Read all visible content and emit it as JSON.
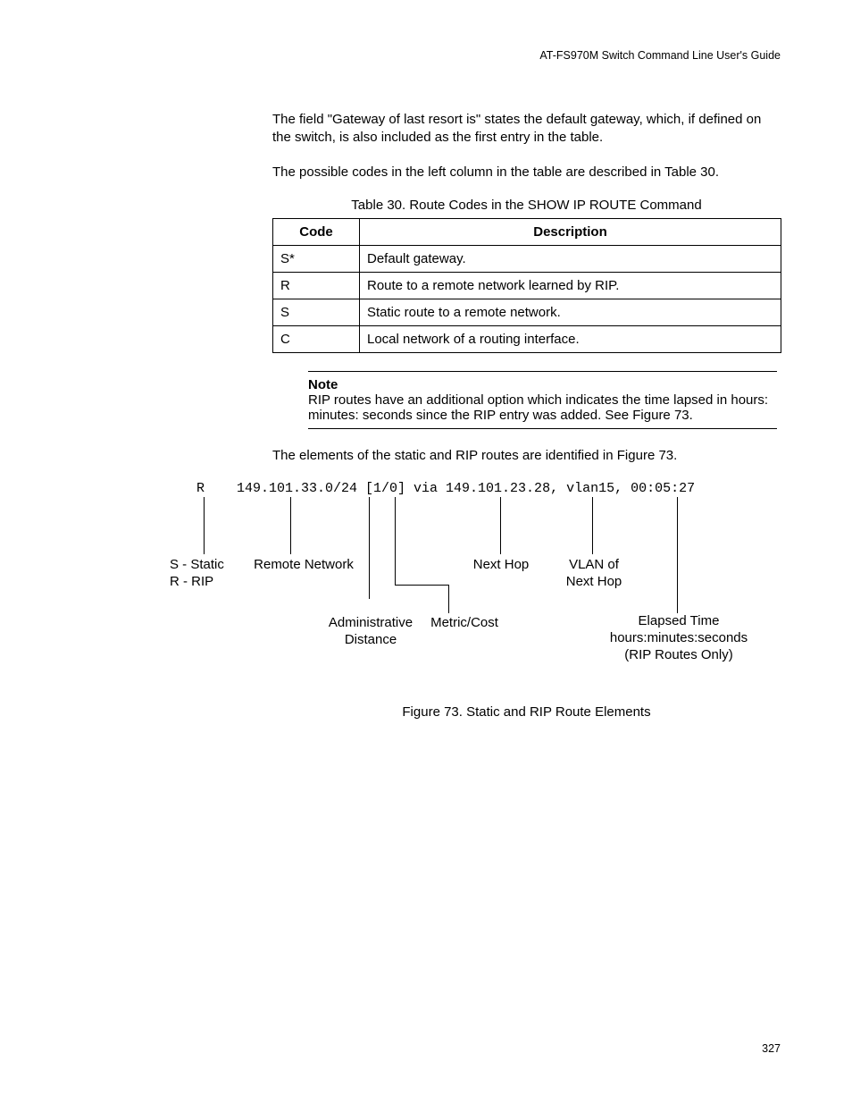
{
  "header": "AT-FS970M Switch Command Line User's Guide",
  "para1": "The field \"Gateway of last resort is\" states the default gateway, which, if defined on the switch, is also included as the first entry in the table.",
  "para2": "The possible codes in the left column in the table are described in Table 30.",
  "table": {
    "caption": "Table 30. Route Codes in the SHOW IP ROUTE Command",
    "headers": {
      "col1": "Code",
      "col2": "Description"
    },
    "rows": [
      {
        "code": "S*",
        "desc": "Default gateway."
      },
      {
        "code": "R",
        "desc": "Route to a remote network learned by RIP."
      },
      {
        "code": "S",
        "desc": "Static route to a remote network."
      },
      {
        "code": "C",
        "desc": "Local network of a routing interface."
      }
    ]
  },
  "note": {
    "title": "Note",
    "body": "RIP routes have an additional option which indicates the time lapsed in hours: minutes: seconds since the RIP entry was added. See Figure 73."
  },
  "para3": "The elements of the static and RIP routes are identified in Figure 73.",
  "figure": {
    "mono": "R    149.101.33.0/24 [1/0] via 149.101.23.28, vlan15, 00:05:27",
    "labels": {
      "static_rip": "S - Static\nR - RIP",
      "remote_network": "Remote Network",
      "next_hop": "Next Hop",
      "vlan": "VLAN of\nNext Hop",
      "admin_dist": "Administrative\nDistance",
      "metric": "Metric/Cost",
      "elapsed": "Elapsed Time\nhours:minutes:seconds\n(RIP Routes Only)"
    },
    "caption": "Figure 73. Static and RIP Route Elements"
  },
  "page_number": "327"
}
